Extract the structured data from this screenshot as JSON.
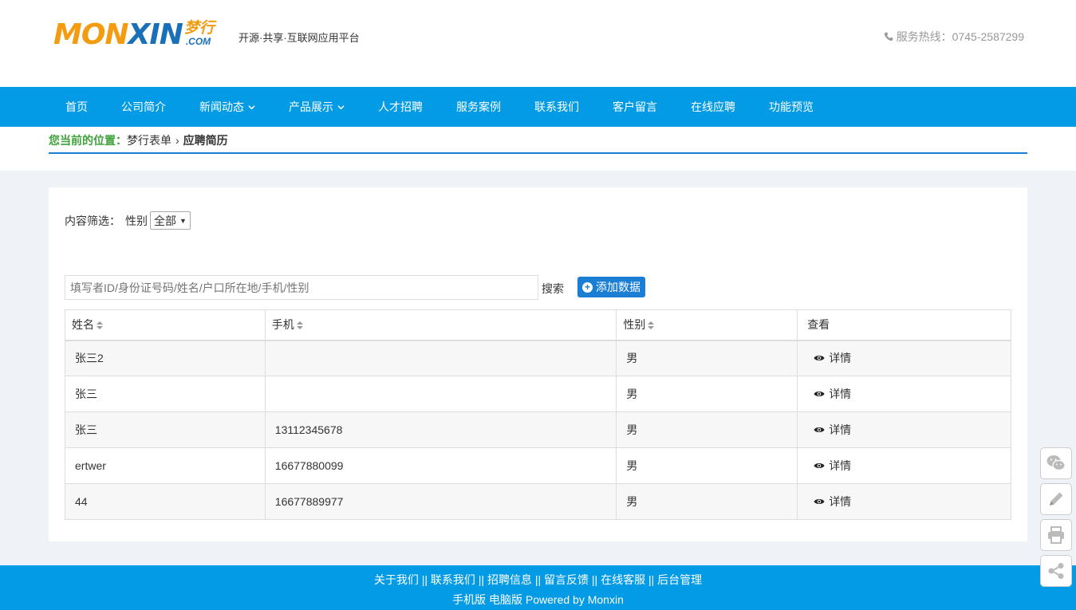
{
  "header": {
    "logo": {
      "part1": "MON",
      "part2": "XIN",
      "cn": "梦行",
      "com": ".COM"
    },
    "slogan": "开源·共享·互联网应用平台",
    "hotline": "服务热线：0745-2587299"
  },
  "nav": {
    "items": [
      {
        "label": "首页"
      },
      {
        "label": "公司简介"
      },
      {
        "label": "新闻动态"
      },
      {
        "label": "产品展示"
      },
      {
        "label": "人才招聘"
      },
      {
        "label": "服务案例"
      },
      {
        "label": "联系我们"
      },
      {
        "label": "客户留言"
      },
      {
        "label": "在线应聘"
      },
      {
        "label": "功能预览"
      }
    ]
  },
  "breadcrumb": {
    "label": "您当前的位置：",
    "parent": "梦行表单",
    "separator": "›",
    "current": "应聘简历"
  },
  "filter": {
    "label": "内容筛选：",
    "field": "性别",
    "selected": "全部"
  },
  "search": {
    "placeholder": "填写者ID/身份证号码/姓名/户口所在地/手机/性别",
    "button": "搜索",
    "add_button": "添加数据"
  },
  "table": {
    "headers": [
      "姓名",
      "手机",
      "性别",
      "查看"
    ],
    "rows": [
      {
        "name": "张三2",
        "phone": "",
        "gender": "男",
        "action": "详情"
      },
      {
        "name": "张三",
        "phone": "",
        "gender": "男",
        "action": "详情"
      },
      {
        "name": "张三",
        "phone": "13112345678",
        "gender": "男",
        "action": "详情"
      },
      {
        "name": "ertwer",
        "phone": "16677880099",
        "gender": "男",
        "action": "详情"
      },
      {
        "name": "44",
        "phone": "16677889977",
        "gender": "男",
        "action": "详情"
      }
    ]
  },
  "footer": {
    "links": [
      "关于我们",
      "联系我们",
      "招聘信息",
      "留言反馈",
      "在线客服",
      "后台管理"
    ],
    "divider": "||",
    "sub": "手机版 电脑版 Powered by Monxin"
  },
  "colors": {
    "nav_bg": "#039be5",
    "accent": "#1a7fd4",
    "logo_orange": "#f39c12",
    "breadcrumb_label": "#3fa23a",
    "page_bg": "#eff2f6"
  },
  "icons": [
    "phone-icon",
    "chevron-down-icon",
    "plus-circle-icon",
    "eye-icon",
    "wechat-icon",
    "pencil-icon",
    "printer-icon",
    "share-icon"
  ]
}
